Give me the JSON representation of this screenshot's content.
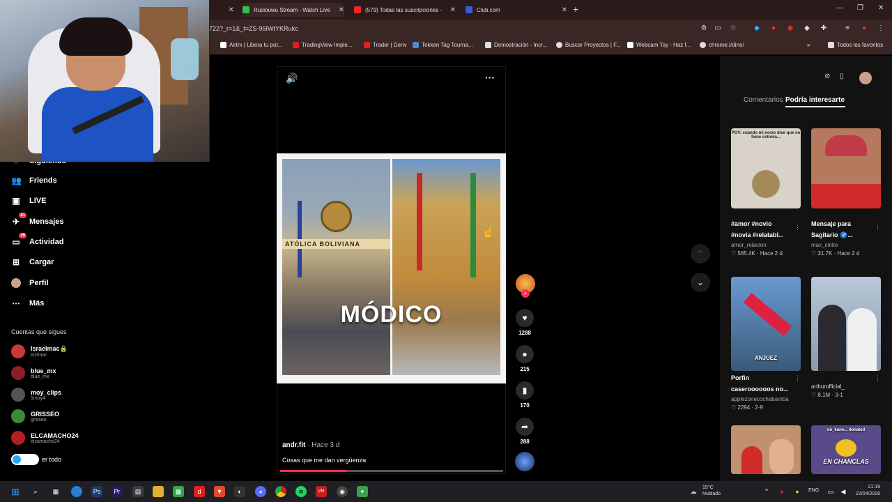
{
  "browser": {
    "tabs": [
      {
        "title": "Rusiouwu Stream - Watch Live",
        "color": "#2ec24a"
      },
      {
        "title": "(579) Todas las suscripciones -",
        "color": "#ff2020"
      },
      {
        "title": "Club.com",
        "color": "#3b5bdb"
      }
    ],
    "url": "722?_r=1&_t=ZS-95IWtYKRukc",
    "bookmarks": [
      {
        "label": "Airtm | Libera tu pot...",
        "color": "#ffffff"
      },
      {
        "label": "TradingView Imple...",
        "color": "#e02020"
      },
      {
        "label": "Trader | Deriv",
        "color": "#e02020"
      },
      {
        "label": "Tekken Tag Tourna...",
        "color": "#4a8bd4"
      },
      {
        "label": "Demostración - Incr...",
        "color": "#dddddd"
      },
      {
        "label": "Buscar Proyectos | F...",
        "color": "#dddddd"
      },
      {
        "label": "Webcam Toy - Haz f...",
        "color": "#ffffff"
      },
      {
        "label": "chrome://dino/",
        "color": "#dddddd"
      }
    ],
    "all_favorites": "Todos los favoritos"
  },
  "sidebar": {
    "partial_top": "Siguiendo",
    "items": [
      {
        "label": "Friends",
        "icon": "friends-icon",
        "glyph": "👥"
      },
      {
        "label": "LIVE",
        "icon": "live-icon",
        "glyph": "▣"
      },
      {
        "label": "Mensajes",
        "icon": "messages-icon",
        "glyph": "✈",
        "badge": "51"
      },
      {
        "label": "Actividad",
        "icon": "activity-icon",
        "glyph": "▭",
        "badge": "29"
      },
      {
        "label": "Cargar",
        "icon": "upload-icon",
        "glyph": "⊞"
      },
      {
        "label": "Perfil",
        "icon": "profile-icon",
        "glyph": "●"
      },
      {
        "label": "Más",
        "icon": "more-icon",
        "glyph": "⋯"
      }
    ],
    "following_title": "Cuentas que sigues",
    "accounts": [
      {
        "name": "Israelmac🔒",
        "handle": "Iszimac",
        "color": "#c83a3a"
      },
      {
        "name": "blue_mx",
        "handle": "blue_mx",
        "color": "#8a1f2a"
      },
      {
        "name": "moy_clips",
        "handle": "1moy4",
        "color": "#555555"
      },
      {
        "name": "GRISSEO",
        "handle": "grisseo",
        "color": "#3a8a3a"
      },
      {
        "name": "ELCAMACHO24",
        "handle": "elcamacho24",
        "color": "#b02020"
      }
    ],
    "see_all": "er todo"
  },
  "video": {
    "overlay_text": "MÓDICO",
    "banner_text": "ATÓLICA BOLIVIANA",
    "author": "andr.fit",
    "time": " · Hace 3 d",
    "description": "Cosas que me dan vergüenza",
    "progress": 0.3
  },
  "actions": [
    {
      "icon": "heart-icon",
      "glyph": "♥",
      "count": "1288"
    },
    {
      "icon": "comment-icon",
      "glyph": "💬",
      "count": "215"
    },
    {
      "icon": "bookmark-icon",
      "glyph": "🔖",
      "count": "170"
    },
    {
      "icon": "share-icon",
      "glyph": "➦",
      "count": "288"
    }
  ],
  "right_panel": {
    "tab_comments": "Comentarios",
    "tab_interest": "Podría interesarte",
    "cards": [
      {
        "title": "#amor #novio\n#novia #relatabl...",
        "author": "amor_relacion",
        "stats": "♡ 565.4K · Hace 2 d",
        "overlay": "POV: cuando mi novio dice que no tiene colonia...",
        "bg": "#d8d2c8"
      },
      {
        "title": "Mensaje para\nSagitario ♐...",
        "author": "max_cintio",
        "stats": "♡ 31.7K · Hace 2 d",
        "overlay": "",
        "bg": "#b57a5e"
      },
      {
        "title": "Porfin\ncaseroooooos no...",
        "author": "applezonecochabamba",
        "stats": "♡ 2294 · 2-9",
        "overlay": "ANJUEZ",
        "bg": "#3a6a9a"
      },
      {
        "title": "",
        "author": "arthurofficial_",
        "stats": "♡ 8.1M · 3-1",
        "overlay": "",
        "bg": "#a8b0b8"
      },
      {
        "title": "",
        "author": "",
        "stats": "",
        "overlay": "",
        "bg": "#c09070"
      },
      {
        "title": "",
        "author": "",
        "stats": "",
        "overlay": "EN CHANCLAS",
        "bg": "#5a4a8a"
      }
    ],
    "card5_overlay_top": "un_kane... donated"
  },
  "taskbar": {
    "weather_temp": "15°C",
    "weather_desc": "Nublado",
    "lang": "ENG",
    "time": "21:19",
    "date": "22/04/2026"
  }
}
